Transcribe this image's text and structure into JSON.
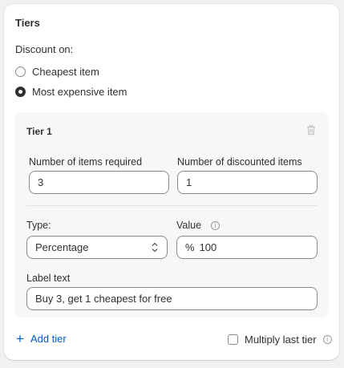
{
  "section": {
    "title": "Tiers",
    "discount_on_label": "Discount on:",
    "options": [
      {
        "label": "Cheapest item",
        "selected": false
      },
      {
        "label": "Most expensive item",
        "selected": true
      }
    ]
  },
  "tier": {
    "title": "Tier 1",
    "items_required_label": "Number of items required",
    "items_required_value": "3",
    "discounted_items_label": "Number of discounted items",
    "discounted_items_value": "1",
    "type_label": "Type:",
    "type_value": "Percentage",
    "value_label": "Value",
    "value_prefix": "%",
    "value_value": "100",
    "label_text_label": "Label text",
    "label_text_value": "Buy 3, get 1 cheapest for free"
  },
  "footer": {
    "add_tier_label": "Add tier",
    "multiply_label": "Multiply last tier",
    "multiply_checked": false
  },
  "colors": {
    "accent": "#005bd3",
    "text": "#303030",
    "panel": "#f7f7f7"
  }
}
